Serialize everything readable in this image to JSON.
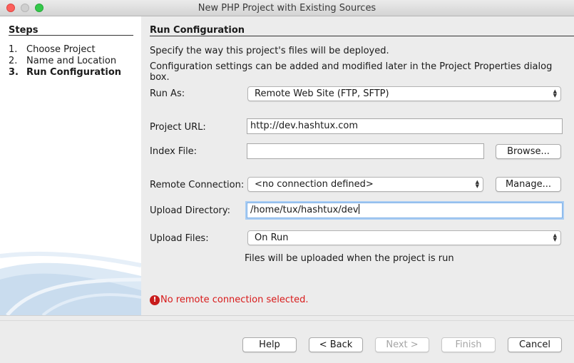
{
  "window": {
    "title": "New PHP Project with Existing Sources"
  },
  "steps": {
    "title": "Steps",
    "items": [
      {
        "num": "1.",
        "label": "Choose Project"
      },
      {
        "num": "2.",
        "label": "Name and Location"
      },
      {
        "num": "3.",
        "label": "Run Configuration"
      }
    ]
  },
  "main": {
    "title": "Run Configuration",
    "desc1": "Specify the way this project's files will be deployed.",
    "desc2": "Configuration settings can be added and modified later in the Project Properties dialog box.",
    "run_as": {
      "label": "Run As:",
      "value": "Remote Web Site (FTP, SFTP)"
    },
    "project_url": {
      "label": "Project URL:",
      "value": "http://dev.hashtux.com"
    },
    "index_file": {
      "label": "Index File:",
      "value": "",
      "browse": "Browse..."
    },
    "remote_connection": {
      "label": "Remote Connection:",
      "value": "<no connection defined>",
      "manage": "Manage..."
    },
    "upload_directory": {
      "label": "Upload Directory:",
      "value": "/home/tux/hashtux/dev"
    },
    "upload_files": {
      "label": "Upload Files:",
      "value": "On Run",
      "note": "Files will be uploaded when the project is run"
    },
    "error": "No remote connection selected."
  },
  "buttons": {
    "help": "Help",
    "back": "< Back",
    "next": "Next >",
    "finish": "Finish",
    "cancel": "Cancel"
  },
  "colors": {
    "error": "#d81a1a",
    "focus": "#a9cdf3",
    "accent": "#3b80d6"
  }
}
